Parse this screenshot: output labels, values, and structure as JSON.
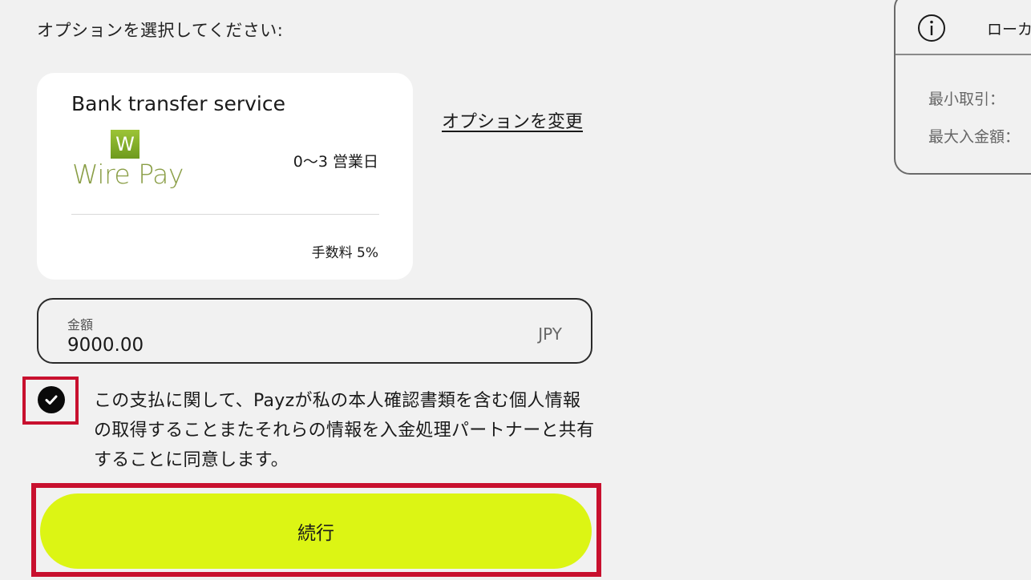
{
  "prompt": "オプションを選択してください:",
  "option": {
    "title": "Bank transfer service",
    "logo_badge": "W",
    "logo_text": "Wire Pay",
    "processing_time": "0～3 営業日",
    "fee": "手数料 5%"
  },
  "change_option_label": "オプションを変更",
  "amount": {
    "label": "金額",
    "value": "9000.00",
    "currency": "JPY"
  },
  "consent": {
    "checked": true,
    "text": "この支払に関して、Payzが私の本人確認書類を含む個人情報の取得することまたそれらの情報を入金処理パートナーと共有することに同意します。"
  },
  "continue_label": "続行",
  "info_panel": {
    "title": "ローカ",
    "min_transaction_label": "最小取引：",
    "max_deposit_label": "最大入金額："
  },
  "colors": {
    "background": "#f1f1f1",
    "accent_button": "#dcf514",
    "highlight_red": "#c8102e",
    "logo_green": "#8a9e46"
  }
}
